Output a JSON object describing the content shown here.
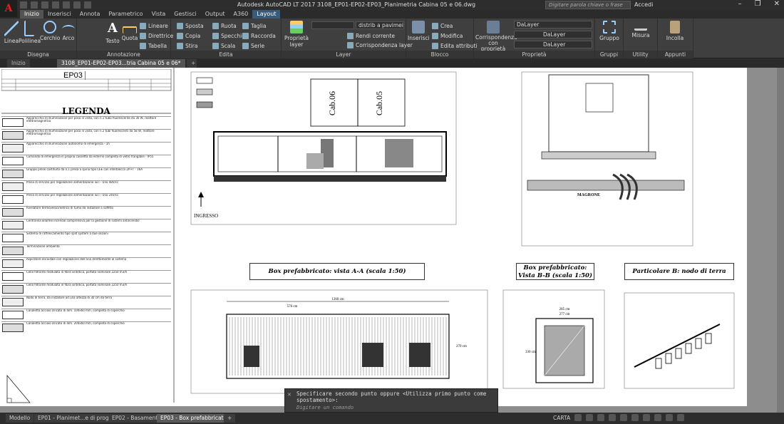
{
  "app": {
    "logo_letter": "A",
    "title": "Autodesk AutoCAD LT 2017   3108_EP01-EP02-EP03_Planimetria Cabina 05 e 06.dwg",
    "search_placeholder": "Digitare parola chiave o frase",
    "user_label": "Accedi"
  },
  "menu_tabs": [
    "Inizio",
    "Inserisci",
    "Annota",
    "Parametrico",
    "Vista",
    "Gestisci",
    "Output",
    "A360",
    "Layout"
  ],
  "ribbon": {
    "draw": {
      "label": "Disegna",
      "buttons": [
        "Linea",
        "Polilinea",
        "Cerchio",
        "Arco"
      ]
    },
    "annotation": {
      "label": "Annotazione",
      "buttons": [
        "Testo",
        "Quota"
      ],
      "small": [
        "Lineare",
        "Direttrice",
        "Tabella"
      ]
    },
    "modify": {
      "label": "Edita",
      "small": [
        "Sposta",
        "Ruota",
        "Taglia",
        "Copia",
        "Specchio",
        "Raccorda",
        "Stira",
        "Scala",
        "Serie"
      ]
    },
    "layer": {
      "label": "Layer",
      "big": "Proprietà layer",
      "dropdown": "distrib a pavimei",
      "small": [
        "Rendi corrente",
        "Corrispondenza layer"
      ]
    },
    "block": {
      "label": "Blocco",
      "big": "Inserisci",
      "small": [
        "Crea",
        "Modifica",
        "Edita attributi"
      ]
    },
    "properties": {
      "label": "Proprietà",
      "big": "Corrispondenza con proprietà",
      "dropdowns": [
        "DaLayer",
        "DaLayer",
        "DaLayer"
      ]
    },
    "groups": {
      "label": "Gruppi",
      "big": "Gruppo"
    },
    "utilities": {
      "label": "Utility",
      "big": "Misura"
    },
    "clipboard": {
      "label": "Appunti",
      "big": "Incolla"
    }
  },
  "doc_tabs": [
    "Inizio",
    "3108_EP01-EP02-EP03...tria Cabina 05 e 06*"
  ],
  "legend": {
    "ep_code": "EP03",
    "title": "LEGENDA",
    "rows": [
      "Apparecchio di illuminazione per posa in vista, con n.1 tubo fluorescente da 36 W, reattore elettromagnetico",
      "Apparecchio di illuminazione per posa in vista, con n.2 tubi fluorescenti da 58 W, reattore elettromagnetico",
      "Apparecchio di illuminazione autonomo di emergenza - 1h",
      "Comando di emergenza in propria cassetta da esterno completa di vetro frangibile - IP55",
      "Gruppo prese costituito da n.1 presa a spina tipo CEE con interblocco 2P+T - 16A",
      "Presa di servizio per regolazione alimentazione luci - Uno 48V/cc",
      "Presa di servizio per regolazione alimentazione luci - Uno 24V/cc",
      "Rivelatore termovelocimetrico di fumo da installare a soffitto",
      "Centralina allarme incendio comprensiva per la gestione di sistemi antincendio",
      "Sistema di raffrescamento tipo split system a due sezioni",
      "Terminazione ambiente",
      "Aspiratore elicoidale con regolazione dell'aria direttamente al sistema",
      "Cella filtrante modulata in fibra sintetica, portata nominale 2250 m3/h",
      "Cella filtrante modulata in fibra sintetica, portata nominale 2250 m3/h",
      "Nodo di terra, da installare ad una altezza di 30 cm da terra",
      "Canaletta acciaio zincato di dim. 100x60 mm, completa di coperchio",
      "Canaletta acciaio zincato di dim. 200x60 mm, completa di coperchio"
    ]
  },
  "drawing": {
    "cab06": "Cab.06",
    "cab05": "Cab.05",
    "ingresso": "INGRESSO",
    "view_aa": "Box prefabbricato: vista A-A (scala 1:50)",
    "view_bb": "Box prefabbricato: Vista B-B (scala 1:50)",
    "detail_b": "Particolare B: nodo di terra",
    "magrone": "MAGRONE",
    "dim_1260": "1260 cm",
    "dim_576": "576 cm",
    "dim_270": "270 cm",
    "dim_285": "285 cm",
    "dim_277": "277 cm",
    "dim_330": "330 cm"
  },
  "command": {
    "prompt": "Specificare secondo punto oppure <Utilizza primo punto come spostamento>:",
    "input_placeholder": "Digitare un comando"
  },
  "layout_tabs": [
    "Modello",
    "EP01 - Planimet...e di progetto",
    "EP02 - Basamento",
    "EP03 - Box prefabbricato"
  ],
  "status": {
    "space": "CARTA"
  }
}
